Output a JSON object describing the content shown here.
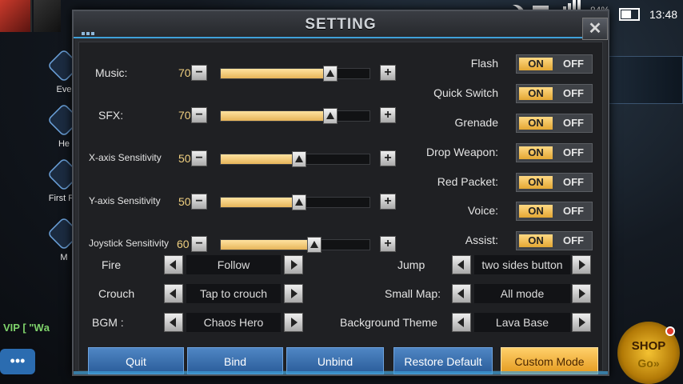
{
  "background": {
    "side_items": [
      "Eve",
      "He",
      "First Re",
      "M"
    ],
    "vip_text": "VIP [ \"Wа",
    "shop": {
      "label": "SHOP",
      "go": "Go»"
    }
  },
  "status_bar": {
    "network": "H+",
    "battery_percent": "84%",
    "time": "13:48"
  },
  "dialog": {
    "title": "SETTING",
    "close_label": "✕"
  },
  "sliders": [
    {
      "label": "Music:",
      "value": "70",
      "level": 0.7
    },
    {
      "label": "SFX:",
      "value": "70",
      "level": 0.7
    },
    {
      "label": "X-axis Sensitivity",
      "value": "50",
      "level": 0.5
    },
    {
      "label": "Y-axis Sensitivity",
      "value": "50",
      "level": 0.5
    },
    {
      "label": "Joystick Sensitivity",
      "value": "60",
      "level": 0.6
    }
  ],
  "slider_buttons": {
    "minus": "−",
    "plus": "+"
  },
  "toggles": [
    {
      "label": "Flash",
      "on": "ON",
      "off": "OFF",
      "state": "on"
    },
    {
      "label": "Quick Switch",
      "on": "ON",
      "off": "OFF",
      "state": "on"
    },
    {
      "label": "Grenade",
      "on": "ON",
      "off": "OFF",
      "state": "on"
    },
    {
      "label": "Drop Weapon:",
      "on": "ON",
      "off": "OFF",
      "state": "on"
    },
    {
      "label": "Red Packet:",
      "on": "ON",
      "off": "OFF",
      "state": "on"
    },
    {
      "label": "Voice:",
      "on": "ON",
      "off": "OFF",
      "state": "on"
    },
    {
      "label": "Assist:",
      "on": "ON",
      "off": "OFF",
      "state": "on"
    }
  ],
  "selectors_left": [
    {
      "label": "Fire",
      "value": "Follow"
    },
    {
      "label": "Crouch",
      "value": "Tap to crouch"
    },
    {
      "label": "BGM :",
      "value": "Chaos Hero"
    }
  ],
  "selectors_right": [
    {
      "label": "Jump",
      "value": "two sides button"
    },
    {
      "label": "Small Map:",
      "value": "All mode"
    },
    {
      "label": "Background Theme",
      "value": "Lava Base"
    }
  ],
  "buttons": {
    "quit": "Quit",
    "bind": "Bind",
    "unbind": "Unbind",
    "restore_default": "Restore Default",
    "custom_mode": "Custom Mode"
  },
  "colors": {
    "accent_blue": "#3fa0d8",
    "toggle_on": "#f2c14e",
    "slider_fill": "#f3cf86",
    "custom_mode": "#f5b53c"
  }
}
